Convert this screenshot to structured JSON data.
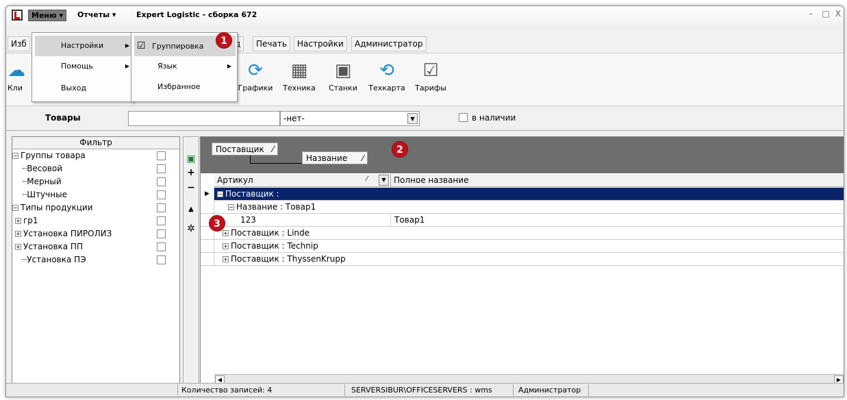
{
  "titlebar": {
    "menu_label": "Меню",
    "reports_label": "Отчеты",
    "app_title": "Expert Logistic - сборка 672",
    "minimize": "–",
    "maximize": "□",
    "close": "X"
  },
  "tabs": [
    "Изб",
    "д",
    "Печать",
    "Настройки",
    "Администратор"
  ],
  "ribbon": [
    {
      "label": "Кли",
      "icon": "clients-icon"
    },
    {
      "label": "Графики",
      "icon": "schedule-icon"
    },
    {
      "label": "Техника",
      "icon": "machinery-icon"
    },
    {
      "label": "Станки",
      "icon": "machine-tools-icon"
    },
    {
      "label": "Техкарта",
      "icon": "techcard-icon"
    },
    {
      "label": "Тарифы",
      "icon": "tariffs-icon"
    }
  ],
  "filter_bar": {
    "label": "Товары",
    "search_value": "",
    "select_value": "-нет-",
    "checkbox_label": "в наличии",
    "checkbox_checked": false
  },
  "filter_panel": {
    "header": "Фильтр",
    "rows": [
      {
        "label": "Группы товара",
        "toggle": "−",
        "level": 0
      },
      {
        "label": "Весовой",
        "toggle": "",
        "level": 1
      },
      {
        "label": "Мерный",
        "toggle": "",
        "level": 1
      },
      {
        "label": "Штучные",
        "toggle": "",
        "level": 1
      },
      {
        "label": "Типы продукции",
        "toggle": "−",
        "level": 0
      },
      {
        "label": "гр1",
        "toggle": "+",
        "level": 1
      },
      {
        "label": "Установка ПИРОЛИЗ",
        "toggle": "+",
        "level": 1
      },
      {
        "label": "Установка ПП",
        "toggle": "+",
        "level": 1
      },
      {
        "label": "Установка ПЭ",
        "toggle": "",
        "level": 1
      }
    ]
  },
  "side_toolbar": {
    "add": "+",
    "remove": "−",
    "up": "▲"
  },
  "grid": {
    "group_chips": {
      "supplier": "Поставщик",
      "name": "Название",
      "sort_glyph": "⁄"
    },
    "columns": {
      "article": "Артикул",
      "full_name": "Полное название"
    },
    "rows": [
      {
        "text": "Поставщик :",
        "toggle": "−",
        "level": 0,
        "selected": true
      },
      {
        "text": "Название : Товар1",
        "toggle": "−",
        "level": 1,
        "selected": false
      },
      {
        "article": "123",
        "full_name": "Товар1",
        "level": 2,
        "selected": false
      },
      {
        "text": "Поставщик : Linde",
        "toggle": "+",
        "level": 0,
        "selected": false
      },
      {
        "text": "Поставщик : Technip",
        "toggle": "+",
        "level": 0,
        "selected": false
      },
      {
        "text": "Поставщик : ThyssenKrupp",
        "toggle": "+",
        "level": 0,
        "selected": false
      }
    ]
  },
  "menu_level1": [
    {
      "label": "Настройки",
      "highlighted": true
    },
    {
      "label": "Помощь",
      "highlighted": false
    },
    {
      "label": "Выход",
      "highlighted": false
    }
  ],
  "menu_level2": [
    {
      "label": "Группировка",
      "checked": true,
      "highlighted": true
    },
    {
      "label": "Язык",
      "checked": false,
      "highlighted": false
    },
    {
      "label": "Избранное",
      "checked": false,
      "highlighted": false
    }
  ],
  "badges": [
    "1",
    "2",
    "3"
  ],
  "status": {
    "records": "Количество записей: 4",
    "server": "SERVERSIBUR\\OFFICESERVERS : wms",
    "user": "Администратор"
  },
  "colors": {
    "accent_badge": "#c0111a",
    "selected_row": "#0a246a",
    "group_panel": "#6e6e6e"
  }
}
